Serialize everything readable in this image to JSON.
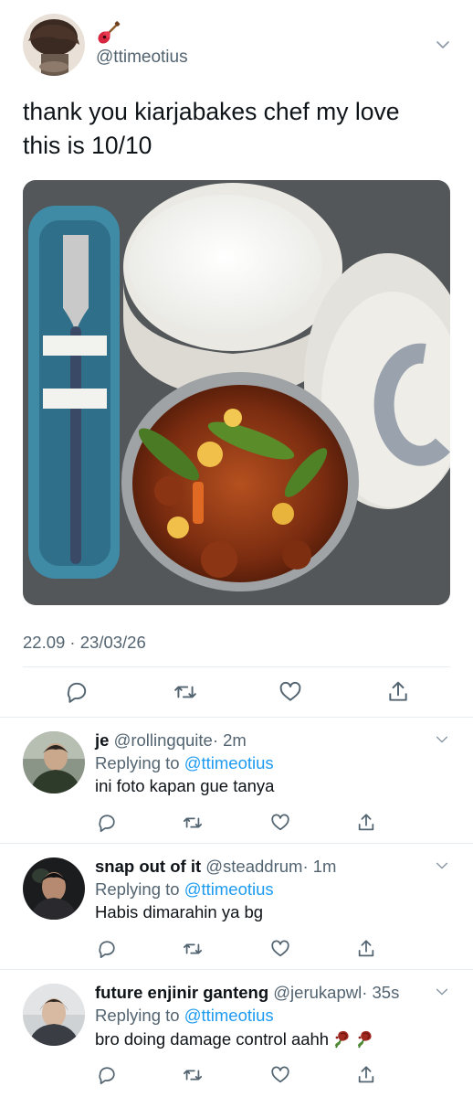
{
  "main_tweet": {
    "emoji": "guitar-emoji",
    "handle": "@ttimeotius",
    "text": "thank you kiarjabakes chef my love this is 10/10",
    "timestamp": "22.09 · 23/03/26",
    "actions": [
      "reply-icon",
      "retweet-icon",
      "like-icon",
      "share-icon"
    ]
  },
  "replies": [
    {
      "name": "je",
      "handle": "@rollingquite",
      "time": "· 2m",
      "replying_prefix": "Replying to ",
      "replying_to": "@ttimeotius",
      "text": "ini foto kapan gue tanya",
      "emoji": []
    },
    {
      "name": "snap out of it",
      "handle": "@steaddrum",
      "time": "· 1m",
      "replying_prefix": "Replying to ",
      "replying_to": "@ttimeotius",
      "text": "Habis dimarahin ya bg",
      "emoji": []
    },
    {
      "name": "future enjinir ganteng",
      "handle": "@jerukapwl",
      "time": "· 35s",
      "replying_prefix": "Replying to ",
      "replying_to": "@ttimeotius",
      "text": "bro doing damage control aahh",
      "emoji": [
        "wilted-rose-emoji",
        "wilted-rose-emoji"
      ]
    }
  ],
  "colors": {
    "text": "#0f1419",
    "secondary": "#536471",
    "link": "#1d9bf0",
    "divider": "#e6ecf0"
  }
}
